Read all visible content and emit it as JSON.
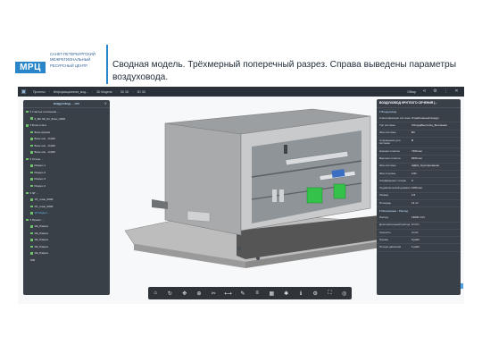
{
  "slide": {
    "logo": "МРЦ",
    "logo_text": "САНКТ-ПЕТЕРБУРГСКИЙ\nМЕЖРЕГИОНАЛЬНЫЙ\nРЕСУРСНЫЙ ЦЕНТР",
    "title": "Сводная модель. Трёхмерный поперечный разрез. Справа выведены параметры воздуховода."
  },
  "topbar": {
    "crumbs": [
      "Проекты",
      "Информационная_мод...",
      "3D Модели",
      "3D 3D",
      "3D 3D"
    ],
    "right_button": "Обзор",
    "right_icons": [
      "share-icon",
      "settings-icon",
      "more-icon",
      "close-icon"
    ]
  },
  "left_panel": {
    "title": "воздуховод ... сеч",
    "items": [
      {
        "label": "▾ Участок отопления ...",
        "checked": true,
        "selected": false
      },
      {
        "label": "0_ВК ЭК_01_Блок_0000",
        "checked": true,
        "selected": false
      },
      {
        "label": "▾ Блок отопл.",
        "checked": true,
        "selected": false
      },
      {
        "label": "Блок кровли",
        "checked": true,
        "selected": false
      },
      {
        "label": "Блок осн. -0,000",
        "checked": true,
        "selected": false
      },
      {
        "label": "Блок осн. -0,000",
        "checked": true,
        "selected": false
      },
      {
        "label": "Блок осн. -0,000",
        "checked": true,
        "selected": false
      },
      {
        "label": "▾ Стены ...",
        "checked": true,
        "selected": false
      },
      {
        "label": "Разрез 1",
        "checked": true,
        "selected": false
      },
      {
        "label": "Разрез 2",
        "checked": true,
        "selected": false
      },
      {
        "label": "Разрез 3",
        "checked": true,
        "selected": false
      },
      {
        "label": "Разрез 4",
        "checked": true,
        "selected": false
      },
      {
        "label": "▾ ЭГ ...",
        "checked": true,
        "selected": false
      },
      {
        "label": "ЭГ_этаж_0000",
        "checked": true,
        "selected": false
      },
      {
        "label": "ЭГ_этаж_0000",
        "checked": true,
        "selected": false
      },
      {
        "label": "ЭГ Модел...",
        "checked": true,
        "selected": true
      },
      {
        "label": "▾ Проект ...",
        "checked": true,
        "selected": false
      },
      {
        "label": "ЭК_Разрез",
        "checked": true,
        "selected": false
      },
      {
        "label": "ЭК_Разрез",
        "checked": true,
        "selected": false
      },
      {
        "label": "ЭК_Разрез",
        "checked": true,
        "selected": false
      },
      {
        "label": "ЭК_Разрез",
        "checked": true,
        "selected": false
      },
      {
        "label": "ЭК_Разрез",
        "checked": true,
        "selected": false
      },
      {
        "label": "000",
        "checked": false,
        "selected": false
      }
    ]
  },
  "right_panel": {
    "title": "ВОЗДУХОВОД КРУГЛОГО СЕЧЕНИЯ (...",
    "section_main": "▾ Воздуховод",
    "section_extra": "▾ Механизмы - Расход",
    "rows": [
      {
        "k": "Классификация системы",
        "v": "Отработанный воздух"
      },
      {
        "k": "Тип системы",
        "v": "ОборудВентиляц_Вытяжная"
      },
      {
        "k": "Имя системы",
        "v": "В3"
      },
      {
        "k": "Сокращение для системы",
        "v": "В"
      },
      {
        "k": "Нижняя отметка",
        "v": "7300 мм"
      },
      {
        "k": "Верхняя отметка",
        "v": "8300 мм"
      },
      {
        "k": "Имя системы",
        "v": "АДНА_Группирование"
      },
      {
        "k": "Имя стороны",
        "v": "1/21"
      },
      {
        "k": "Коэффициент потерь",
        "v": "0"
      },
      {
        "k": "Гидравлический диаметр",
        "v": "1000 мм"
      },
      {
        "k": "Размер",
        "v": "1/4"
      },
      {
        "k": "Площадь",
        "v": "14 m²"
      },
      {
        "k": "Расход",
        "v": "13000 m³/ч"
      },
      {
        "k": "Дополнительный расход",
        "v": "0 m³/ч"
      },
      {
        "k": "Скорость",
        "v": "4 m/c"
      },
      {
        "k": "Трение",
        "v": "0 ра/m"
      },
      {
        "k": "Потеря давления",
        "v": "1 ра/m"
      }
    ]
  },
  "bottom_toolbar": {
    "icons": [
      "home-icon",
      "orbit-icon",
      "pan-icon",
      "zoom-icon",
      "cut-icon",
      "measure-icon",
      "markup-icon",
      "layers-icon",
      "model-icon",
      "explode-icon",
      "properties-icon",
      "settings-icon",
      "fullscreen-icon",
      "vr-icon"
    ]
  },
  "colors": {
    "accent": "#2a86c8",
    "panel_bg": "#3a4048",
    "topbar_bg": "#2b3138",
    "equipment_green": "#34c24a"
  }
}
